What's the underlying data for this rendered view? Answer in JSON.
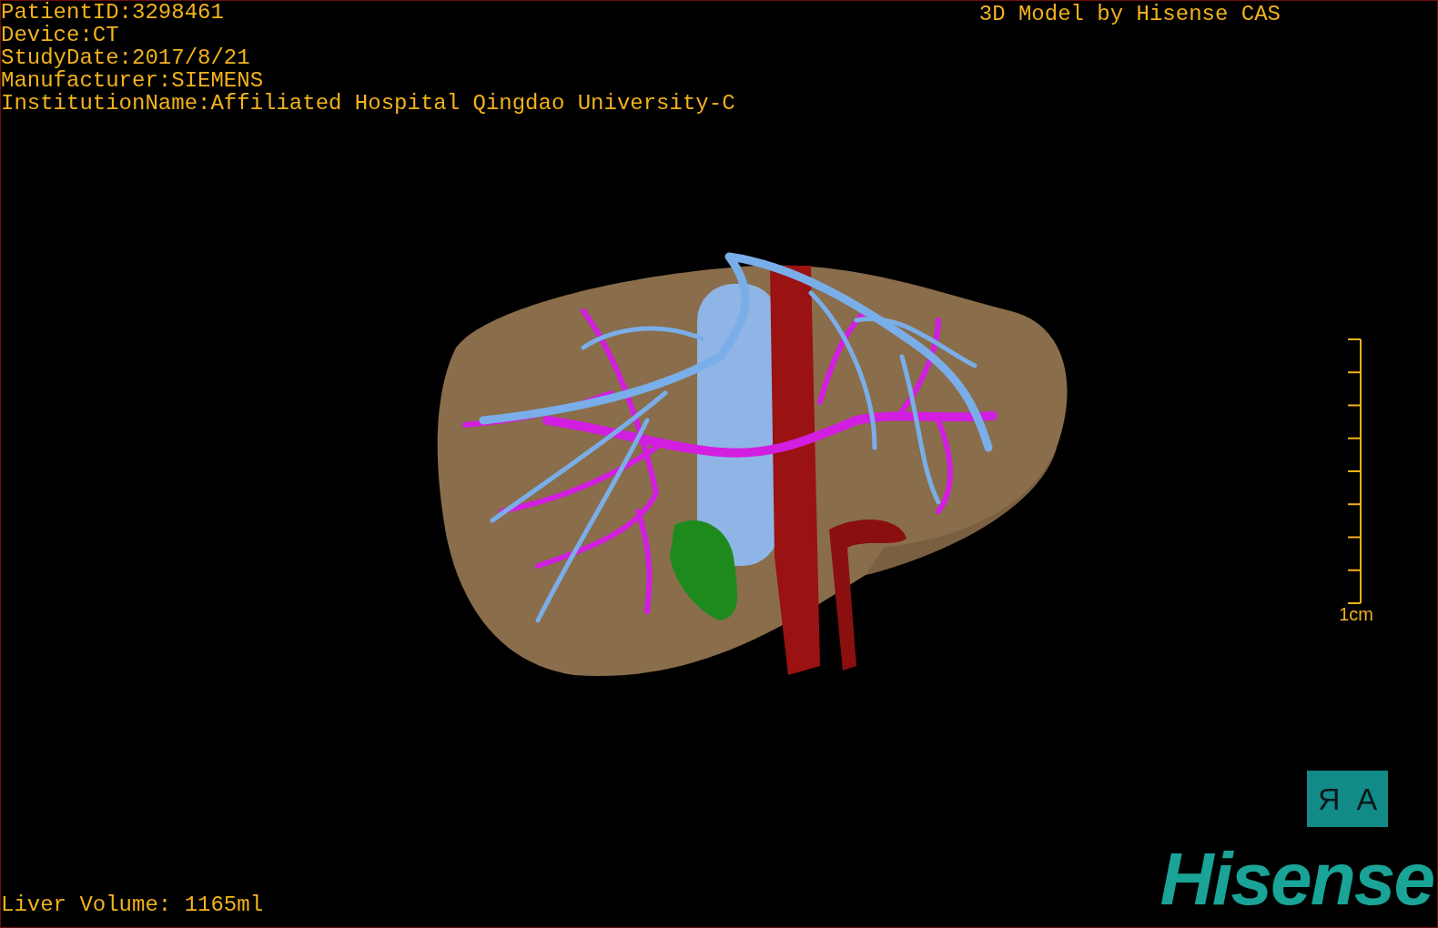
{
  "info": [
    "PatientID:3298461",
    "Device:CT",
    "StudyDate:2017/8/21",
    "Manufacturer:SIEMENS",
    "InstitutionName:Affiliated Hospital Qingdao University-C"
  ],
  "title": "3D Model by Hisense CAS",
  "scale_bar": {
    "label": "1cm"
  },
  "orientation_marker": {
    "labels": [
      "Я",
      "A"
    ]
  },
  "liver_volume": "Liver Volume: 1165ml",
  "logo": "Hisense"
}
